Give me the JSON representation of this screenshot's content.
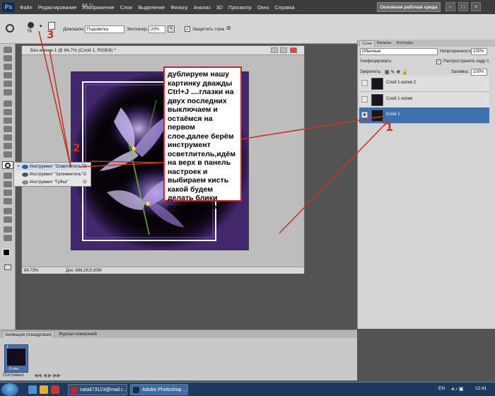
{
  "app": {
    "logo": "Ps",
    "menu": [
      "Файл",
      "Редактирование",
      "Изображение",
      "Слои",
      "Выделение",
      "Фильтр",
      "Анализ",
      "3D",
      "Просмотр",
      "Окно",
      "Справка"
    ],
    "zoom": "84,7",
    "workspace_button": "Основная рабочая среда"
  },
  "options_bar": {
    "brush_size": "79",
    "range_label": "Диапазон:",
    "range_value": "Подсветка",
    "exposure_label": "Экспонир.:",
    "exposure_value": "20%",
    "protect_tones": "Защитить тона"
  },
  "document": {
    "title": "Без имени-1 @ 84,7% (Слой 1, RGB/8) *",
    "zoom_status": "84,73%",
    "doc_info": "Док: 886,2K/2,60M"
  },
  "annotation": {
    "text": "дублируем нашу картинку дважды Ctrl+J ....глазки на двух последних выключаем и остаёмся на первом слое.далее берём инструмент осветлитель,идём на верх в панель настроек и выбираем кисть какой будем делать блики осветлителем",
    "marker_1": "1",
    "marker_2": "2",
    "marker_3": "3"
  },
  "tool_flyout": {
    "items": [
      {
        "label": "Инструмент \"Осветлитель\"",
        "key": "O"
      },
      {
        "label": "Инструмент \"Затемнитель\"",
        "key": "O"
      },
      {
        "label": "Инструмент \"Губка\"",
        "key": "O"
      }
    ]
  },
  "layers_panel": {
    "tabs": [
      "Слои",
      "Каналы",
      "Контуры"
    ],
    "blend_mode": "Обычные",
    "opacity_label": "Непрозрачность:",
    "opacity_value": "100%",
    "unify_label": "Унифицировать:",
    "propagate_label": "Распространить кадр 1",
    "lock_label": "Закрепить:",
    "fill_label": "Заливка:",
    "fill_value": "100%",
    "layers": [
      {
        "name": "Слой 1 копия 2",
        "visible": false,
        "selected": false
      },
      {
        "name": "Слой 1 копия",
        "visible": false,
        "selected": false
      },
      {
        "name": "Слой 1",
        "visible": true,
        "selected": true
      }
    ]
  },
  "animation_panel": {
    "tabs": [
      "Анимация (покадровая)",
      "Журнал измерений"
    ],
    "frame_number": "1",
    "frame_delay": "0 сек.",
    "loop": "Постоянно"
  },
  "taskbar": {
    "items": [
      "natali73123@mail.r...",
      "Adobe Photoshop ..."
    ],
    "lang": "EN",
    "clock": "12:41"
  },
  "colors": {
    "highlight": "#3d6fb1",
    "annotation_border": "#c62828",
    "arrow": "#c0392b"
  }
}
